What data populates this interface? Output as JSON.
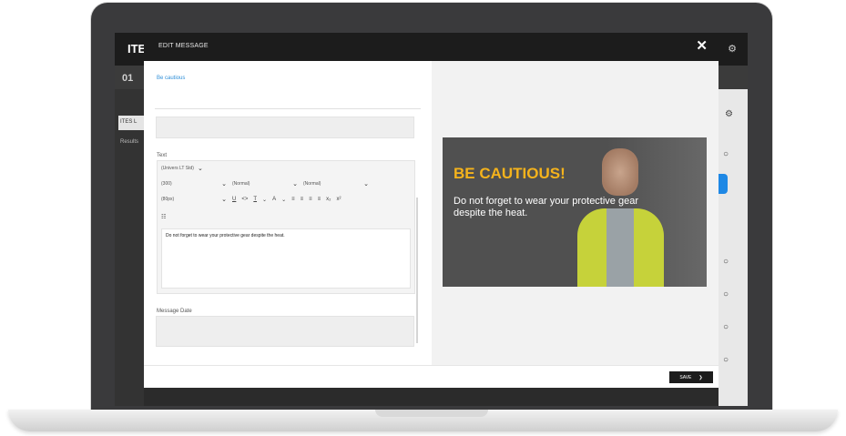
{
  "app": {
    "title": "ITE",
    "step_label": "01",
    "chip_label": "ITES L",
    "results_label": "Results"
  },
  "modal": {
    "title": "EDIT MESSAGE",
    "close_icon": "close-icon",
    "message_name": "Be cautious",
    "text_label": "Text",
    "editor": {
      "font_family": "(Univers LT Std)",
      "font_weight": "(300)",
      "style_normal_1": "(Normal)",
      "style_normal_2": "(Normal)",
      "font_size": "(80px)",
      "content": "Do not forget to wear your protective gear despite the heat."
    },
    "message_date_label": "Message Date",
    "save_label": "SAVE"
  },
  "preview": {
    "title": "BE CAUTIOUS!",
    "text": "Do not forget to wear your protective gear despite the heat.",
    "accent_color": "#f5b31c"
  }
}
